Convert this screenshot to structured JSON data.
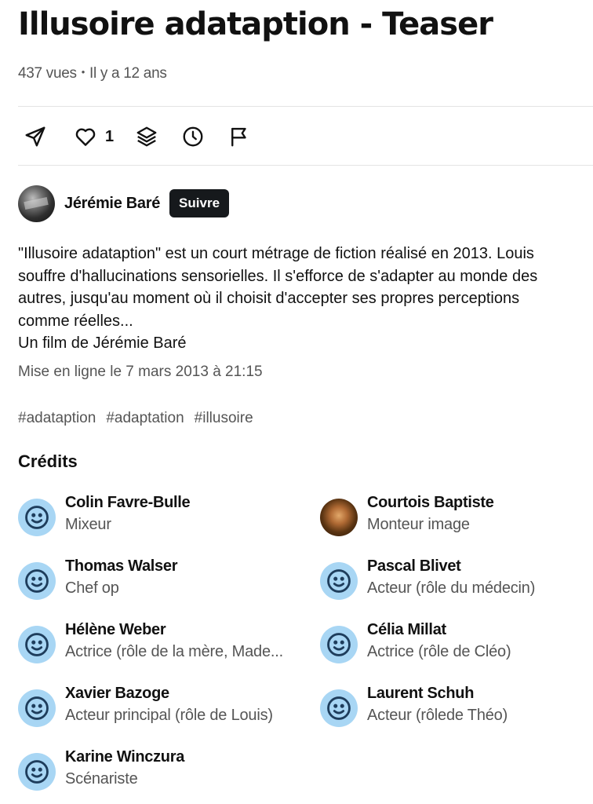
{
  "video": {
    "title": "Illusoire adataption - Teaser",
    "views": "437 vues",
    "separator": "•",
    "age": "Il y a 12 ans",
    "likes": "1"
  },
  "actions": [
    {
      "name": "share-icon"
    },
    {
      "name": "like-icon"
    },
    {
      "name": "collections-icon"
    },
    {
      "name": "watch-later-icon"
    },
    {
      "name": "report-icon"
    }
  ],
  "owner": {
    "name": "Jérémie Baré",
    "follow_label": "Suivre"
  },
  "description": {
    "lines": [
      "\"Illusoire adataption\" est un court métrage de fiction réalisé en 2013. Louis",
      "souffre d'hallucinations sensorielles. Il s'efforce de s'adapter au monde des",
      "autres, jusqu'au moment où il choisit d'accepter ses propres perceptions",
      "comme réelles...",
      "Un film de Jérémie Baré"
    ],
    "published": "Mise en ligne le 7 mars 2013 à 21:15"
  },
  "tags": [
    "#adataption",
    "#adaptation",
    "#illusoire"
  ],
  "credits": {
    "title": "Crédits",
    "people": [
      {
        "name": "Colin Favre-Bulle",
        "role": "Mixeur",
        "avatar": "default"
      },
      {
        "name": "Courtois Baptiste",
        "role": "Monteur image",
        "avatar": "photo"
      },
      {
        "name": "Thomas Walser",
        "role": "Chef op",
        "avatar": "default"
      },
      {
        "name": "Pascal Blivet",
        "role": "Acteur (rôle du médecin)",
        "avatar": "default"
      },
      {
        "name": "Hélène Weber",
        "role": "Actrice (rôle de la mère, Made...",
        "avatar": "default"
      },
      {
        "name": "Célia Millat",
        "role": "Actrice (rôle de Cléo)",
        "avatar": "default"
      },
      {
        "name": "Xavier Bazoge",
        "role": "Acteur principal (rôle de Louis)",
        "avatar": "default"
      },
      {
        "name": "Laurent Schuh",
        "role": "Acteur (rôlede Théo)",
        "avatar": "default"
      },
      {
        "name": "Karine Winczura",
        "role": "Scénariste",
        "avatar": "default"
      }
    ]
  },
  "colors": {
    "avatar_bg": "#a8d6f4",
    "avatar_face": "#1e3d5c",
    "follow_bg": "#16191c",
    "muted_text": "#555555"
  }
}
